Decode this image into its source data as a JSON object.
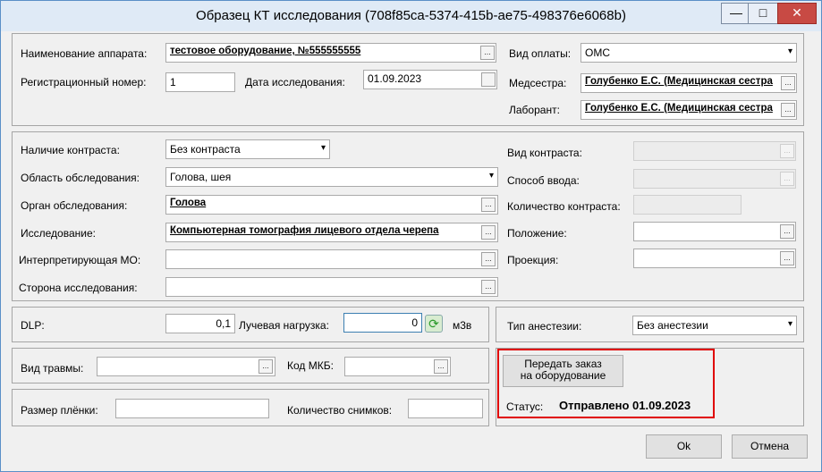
{
  "window": {
    "title": "Образец КТ исследования (708f85ca-5374-415b-ae75-498376e6068b)",
    "minimize": "—",
    "maximize": "□",
    "close": "✕"
  },
  "device_group": {
    "device_label": "Наименование аппарата:",
    "device_value": "тестовое оборудование, №555555555",
    "reg_label": "Регистрационный номер:",
    "reg_value": "1",
    "date_label": "Дата исследования:",
    "date_value": "01.09.2023",
    "pay_label": "Вид оплаты:",
    "pay_value": "ОМС",
    "nurse_label": "Медсестра:",
    "nurse_value": "Голубенко Е.С. (Медицинская сестра",
    "lab_label": "Лаборант:",
    "lab_value": "Голубенко Е.С. (Медицинская сестра"
  },
  "study_group": {
    "contrast_label": "Наличие контраста:",
    "contrast_value": "Без контраста",
    "area_label": "Область обследования:",
    "area_value": "Голова, шея",
    "organ_label": "Орган обследования:",
    "organ_value": "Голова",
    "study_label": "Исследование:",
    "study_value": "Компьютерная томография лицевого отдела черепа",
    "mo_label": "Интерпретирующая МО:",
    "mo_value": "",
    "side_label": "Сторона исследования:",
    "side_value": "",
    "contrast_type_label": "Вид контраста:",
    "input_method_label": "Способ ввода:",
    "contrast_qty_label": "Количество контраста:",
    "position_label": "Положение:",
    "projection_label": "Проекция:"
  },
  "dose_group": {
    "dlp_label": "DLP:",
    "dlp_value": "0,1",
    "ray_label": "Лучевая нагрузка:",
    "ray_value": "0",
    "unit": "м3в"
  },
  "anesthesia": {
    "label": "Тип анестезии:",
    "value": "Без анестезии"
  },
  "trauma_group": {
    "trauma_label": "Вид травмы:",
    "mkb_label": "Код МКБ:"
  },
  "film_group": {
    "size_label": "Размер плёнки:",
    "count_label": "Количество снимков:"
  },
  "order": {
    "send_button_line1": "Передать заказ",
    "send_button_line2": "на оборудование",
    "status_label": "Статус:",
    "status_value": "Отправлено 01.09.2023"
  },
  "footer": {
    "ok_label": "Ok",
    "cancel_label": "Отмена"
  },
  "colors": {
    "highlight": "#e00000"
  }
}
